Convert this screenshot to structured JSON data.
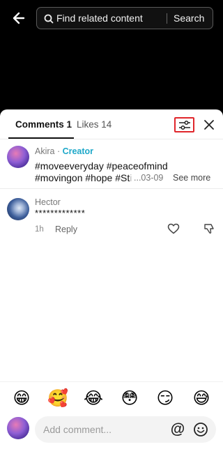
{
  "search": {
    "placeholder": "Find related content",
    "button_label": "Search"
  },
  "tabs": {
    "comments_label": "Comments 1",
    "likes_label": "Likes 14"
  },
  "caption": {
    "author": "Akira",
    "separator": " · ",
    "role_badge": "Creator",
    "line1": "#moveeveryday #peaceofmind",
    "line2_visible": "#movingon #hope #St",
    "line2_faded": "i",
    "date": "...03-09",
    "see_more_label": "See more"
  },
  "comments": [
    {
      "author": "Hector",
      "text": "*************",
      "time": "1h",
      "reply_label": "Reply"
    }
  ],
  "emoji_row": [
    "😁",
    "🥰",
    "😂",
    "😳",
    "😏",
    "😅"
  ],
  "composer": {
    "placeholder": "Add comment...",
    "mention_symbol": "@"
  },
  "icons": {
    "back": "back-arrow-icon",
    "search": "search-icon",
    "filter": "filter-sliders-icon",
    "close": "close-icon",
    "like": "heart-icon",
    "dislike": "dislike-icon",
    "emoji": "emoji-face-icon"
  },
  "colors": {
    "creator_accent": "#1ea8c9",
    "filter_highlight": "#e0262b"
  }
}
